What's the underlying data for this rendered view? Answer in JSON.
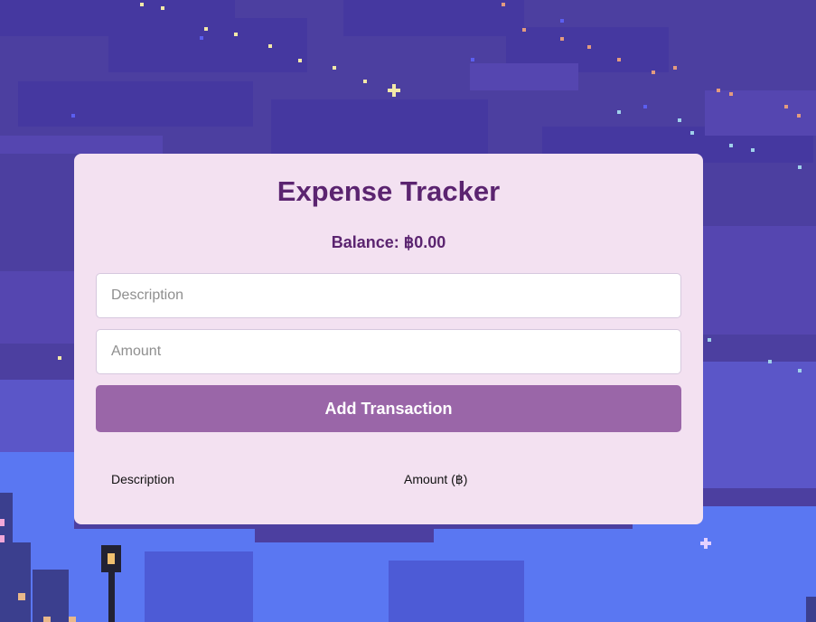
{
  "app": {
    "title": "Expense Tracker",
    "balance_text": "Balance: ฿0.00"
  },
  "form": {
    "description_placeholder": "Description",
    "amount_placeholder": "Amount",
    "add_button_label": "Add Transaction"
  },
  "table": {
    "columns": [
      "Description",
      "Amount (฿)"
    ]
  },
  "colors": {
    "sky": "#4c3fa0",
    "card_bg": "#f3e1f1",
    "title_color": "#5b2470",
    "button_bg": "#9a66a8"
  }
}
